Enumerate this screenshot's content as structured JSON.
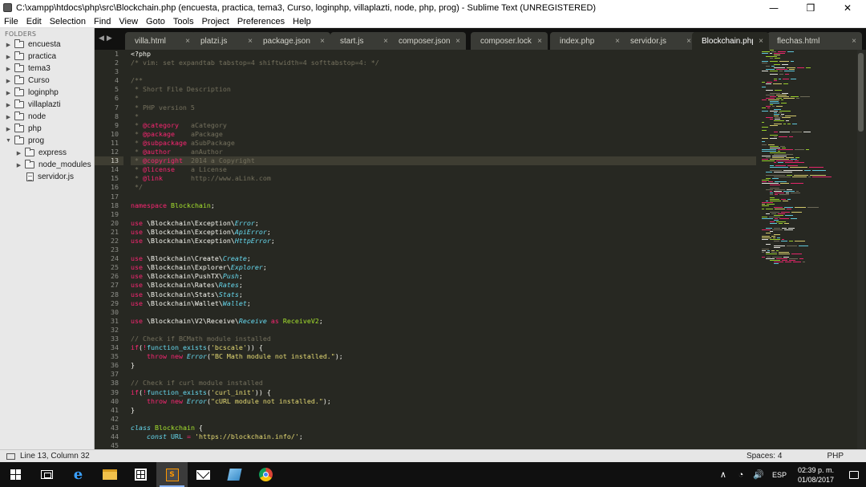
{
  "window": {
    "title": "C:\\xampp\\htdocs\\php\\src\\Blockchain.php (encuesta, practica, tema3, Curso, loginphp, villaplazti, node, php, prog) - Sublime Text (UNREGISTERED)",
    "controls": [
      "minimize",
      "maximize",
      "close"
    ]
  },
  "menu": [
    "File",
    "Edit",
    "Selection",
    "Find",
    "View",
    "Goto",
    "Tools",
    "Project",
    "Preferences",
    "Help"
  ],
  "sidebar": {
    "heading": "FOLDERS",
    "items": [
      {
        "label": "encuesta",
        "type": "folder",
        "depth": 0,
        "expanded": false
      },
      {
        "label": "practica",
        "type": "folder",
        "depth": 0,
        "expanded": false
      },
      {
        "label": "tema3",
        "type": "folder",
        "depth": 0,
        "expanded": false
      },
      {
        "label": "Curso",
        "type": "folder",
        "depth": 0,
        "expanded": false
      },
      {
        "label": "loginphp",
        "type": "folder",
        "depth": 0,
        "expanded": false
      },
      {
        "label": "villaplazti",
        "type": "folder",
        "depth": 0,
        "expanded": false
      },
      {
        "label": "node",
        "type": "folder",
        "depth": 0,
        "expanded": false
      },
      {
        "label": "php",
        "type": "folder",
        "depth": 0,
        "expanded": false
      },
      {
        "label": "prog",
        "type": "folder",
        "depth": 0,
        "expanded": true
      },
      {
        "label": "express",
        "type": "folder",
        "depth": 1,
        "expanded": false
      },
      {
        "label": "node_modules",
        "type": "folder",
        "depth": 1,
        "expanded": false
      },
      {
        "label": "servidor.js",
        "type": "file",
        "depth": 1,
        "expanded": false
      }
    ]
  },
  "tabs": [
    {
      "label": "villa.html",
      "active": false
    },
    {
      "label": "platzi.js",
      "active": false
    },
    {
      "label": "package.json",
      "active": false
    },
    {
      "label": "start.js",
      "active": false
    },
    {
      "label": "composer.json",
      "active": false
    },
    {
      "label": "composer.lock",
      "active": false
    },
    {
      "label": "index.php",
      "active": false
    },
    {
      "label": "servidor.js",
      "active": false
    },
    {
      "label": "Blockchain.php",
      "active": true
    },
    {
      "label": "flechas.html",
      "active": false
    }
  ],
  "editor": {
    "current_line": 13,
    "lines": [
      [
        [
          "t-tag",
          "<?php"
        ]
      ],
      [
        [
          "t-comment",
          "/* vim: set expandtab tabstop=4 shiftwidth=4 softtabstop=4: */"
        ]
      ],
      [],
      [
        [
          "t-comment",
          "/**"
        ]
      ],
      [
        [
          "t-comment",
          " * Short File Description"
        ]
      ],
      [
        [
          "t-comment",
          " *"
        ]
      ],
      [
        [
          "t-comment",
          " * PHP version 5"
        ]
      ],
      [
        [
          "t-comment",
          " *"
        ]
      ],
      [
        [
          "t-comment",
          " * "
        ],
        [
          "t-doctag",
          "@category"
        ],
        [
          "t-comment",
          "   aCategory"
        ]
      ],
      [
        [
          "t-comment",
          " * "
        ],
        [
          "t-doctag",
          "@package"
        ],
        [
          "t-comment",
          "    aPackage"
        ]
      ],
      [
        [
          "t-comment",
          " * "
        ],
        [
          "t-doctag",
          "@subpackage"
        ],
        [
          "t-comment",
          " aSubPackage"
        ]
      ],
      [
        [
          "t-comment",
          " * "
        ],
        [
          "t-doctag",
          "@author"
        ],
        [
          "t-comment",
          "     anAuthor"
        ]
      ],
      [
        [
          "t-comment",
          " * "
        ],
        [
          "t-doctag",
          "@copyright"
        ],
        [
          "t-comment",
          "  2014 a Copyright"
        ]
      ],
      [
        [
          "t-comment",
          " * "
        ],
        [
          "t-doctag",
          "@license"
        ],
        [
          "t-comment",
          "    a License"
        ]
      ],
      [
        [
          "t-comment",
          " * "
        ],
        [
          "t-doctag",
          "@link"
        ],
        [
          "t-comment",
          "       http://www.aLink.com"
        ]
      ],
      [
        [
          "t-comment",
          " */"
        ]
      ],
      [],
      [
        [
          "t-kw",
          "namespace"
        ],
        [
          "t-plain",
          " "
        ],
        [
          "t-ns",
          "Blockchain"
        ],
        [
          "t-plain",
          ";"
        ]
      ],
      [],
      [
        [
          "t-kw",
          "use"
        ],
        [
          "t-plain",
          " \\Blockchain\\Exception\\"
        ],
        [
          "t-type",
          "Error"
        ],
        [
          "t-plain",
          ";"
        ]
      ],
      [
        [
          "t-kw",
          "use"
        ],
        [
          "t-plain",
          " \\Blockchain\\Exception\\"
        ],
        [
          "t-type",
          "ApiError"
        ],
        [
          "t-plain",
          ";"
        ]
      ],
      [
        [
          "t-kw",
          "use"
        ],
        [
          "t-plain",
          " \\Blockchain\\Exception\\"
        ],
        [
          "t-type",
          "HttpError"
        ],
        [
          "t-plain",
          ";"
        ]
      ],
      [],
      [
        [
          "t-kw",
          "use"
        ],
        [
          "t-plain",
          " \\Blockchain\\Create\\"
        ],
        [
          "t-type",
          "Create"
        ],
        [
          "t-plain",
          ";"
        ]
      ],
      [
        [
          "t-kw",
          "use"
        ],
        [
          "t-plain",
          " \\Blockchain\\Explorer\\"
        ],
        [
          "t-type",
          "Explorer"
        ],
        [
          "t-plain",
          ";"
        ]
      ],
      [
        [
          "t-kw",
          "use"
        ],
        [
          "t-plain",
          " \\Blockchain\\PushTX\\"
        ],
        [
          "t-type",
          "Push"
        ],
        [
          "t-plain",
          ";"
        ]
      ],
      [
        [
          "t-kw",
          "use"
        ],
        [
          "t-plain",
          " \\Blockchain\\Rates\\"
        ],
        [
          "t-type",
          "Rates"
        ],
        [
          "t-plain",
          ";"
        ]
      ],
      [
        [
          "t-kw",
          "use"
        ],
        [
          "t-plain",
          " \\Blockchain\\Stats\\"
        ],
        [
          "t-type",
          "Stats"
        ],
        [
          "t-plain",
          ";"
        ]
      ],
      [
        [
          "t-kw",
          "use"
        ],
        [
          "t-plain",
          " \\Blockchain\\Wallet\\"
        ],
        [
          "t-type",
          "Wallet"
        ],
        [
          "t-plain",
          ";"
        ]
      ],
      [],
      [
        [
          "t-kw",
          "use"
        ],
        [
          "t-plain",
          " \\Blockchain\\V2\\Receive\\"
        ],
        [
          "t-type",
          "Receive"
        ],
        [
          "t-plain",
          " "
        ],
        [
          "t-kw",
          "as"
        ],
        [
          "t-plain",
          " "
        ],
        [
          "t-ns",
          "ReceiveV2"
        ],
        [
          "t-plain",
          ";"
        ]
      ],
      [],
      [
        [
          "t-comment",
          "// Check if BCMath module installed"
        ]
      ],
      [
        [
          "t-kw",
          "if"
        ],
        [
          "t-plain",
          "("
        ],
        [
          "t-kw",
          "!"
        ],
        [
          "t-func",
          "function_exists"
        ],
        [
          "t-plain",
          "("
        ],
        [
          "t-str",
          "'bcscale'"
        ],
        [
          "t-plain",
          ")) {"
        ]
      ],
      [
        [
          "t-plain",
          "    "
        ],
        [
          "t-kw",
          "throw"
        ],
        [
          "t-plain",
          " "
        ],
        [
          "t-kw",
          "new"
        ],
        [
          "t-plain",
          " "
        ],
        [
          "t-type",
          "Error"
        ],
        [
          "t-plain",
          "("
        ],
        [
          "t-str",
          "\"BC Math module not installed.\""
        ],
        [
          "t-plain",
          ");"
        ]
      ],
      [
        [
          "t-plain",
          "}"
        ]
      ],
      [],
      [
        [
          "t-comment",
          "// Check if curl module installed"
        ]
      ],
      [
        [
          "t-kw",
          "if"
        ],
        [
          "t-plain",
          "("
        ],
        [
          "t-kw",
          "!"
        ],
        [
          "t-func",
          "function_exists"
        ],
        [
          "t-plain",
          "("
        ],
        [
          "t-str",
          "'curl_init'"
        ],
        [
          "t-plain",
          ")) {"
        ]
      ],
      [
        [
          "t-plain",
          "    "
        ],
        [
          "t-kw",
          "throw"
        ],
        [
          "t-plain",
          " "
        ],
        [
          "t-kw",
          "new"
        ],
        [
          "t-plain",
          " "
        ],
        [
          "t-type",
          "Error"
        ],
        [
          "t-plain",
          "("
        ],
        [
          "t-str",
          "\"cURL module not installed.\""
        ],
        [
          "t-plain",
          ");"
        ]
      ],
      [
        [
          "t-plain",
          "}"
        ]
      ],
      [],
      [
        [
          "t-type",
          "class"
        ],
        [
          "t-plain",
          " "
        ],
        [
          "t-ns",
          "Blockchain"
        ],
        [
          "t-plain",
          " {"
        ]
      ],
      [
        [
          "t-plain",
          "    "
        ],
        [
          "t-type",
          "const"
        ],
        [
          "t-plain",
          " "
        ],
        [
          "t-func",
          "URL"
        ],
        [
          "t-plain",
          " "
        ],
        [
          "t-kw",
          "="
        ],
        [
          "t-plain",
          " "
        ],
        [
          "t-str",
          "'https://blockchain.info/'"
        ],
        [
          "t-plain",
          ";"
        ]
      ],
      []
    ]
  },
  "status": {
    "position": "Line 13, Column 32",
    "indent": "Spaces: 4",
    "syntax": "PHP"
  },
  "taskbar": {
    "apps": [
      "start-button",
      "task-view",
      "edge",
      "file-explorer",
      "store",
      "sublime-text",
      "mail",
      "notepad",
      "chrome"
    ],
    "active_app": "sublime-text",
    "language": "ESP",
    "time": "02:39 p. m.",
    "date": "01/08/2017"
  }
}
